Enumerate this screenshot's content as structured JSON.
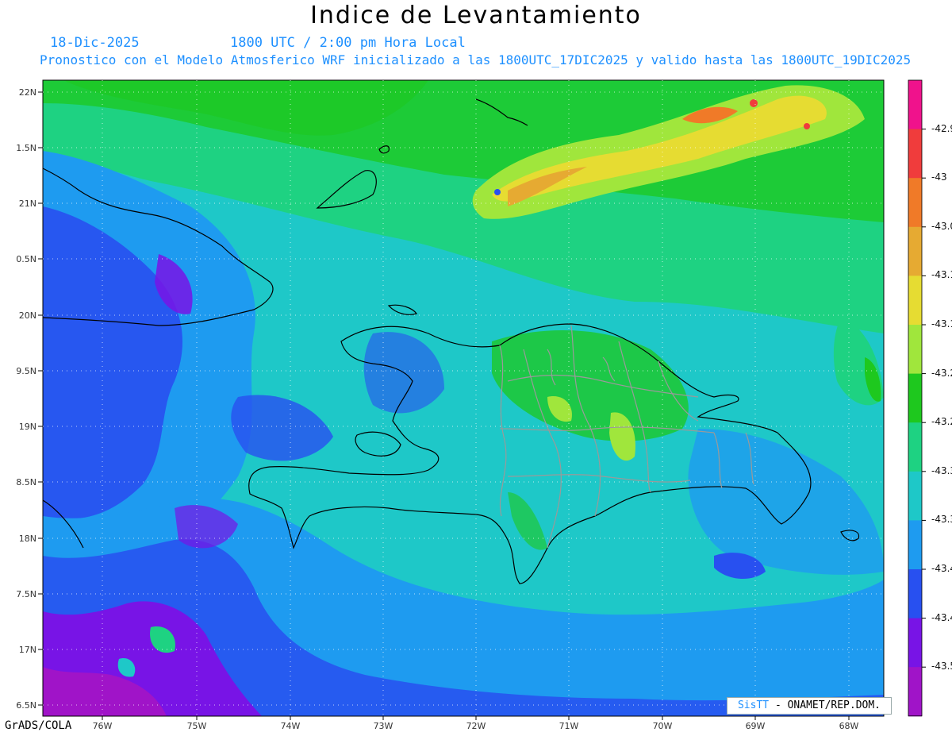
{
  "title": "Indice de Levantamiento",
  "date": "18-Dic-2025",
  "time": "1800 UTC / 2:00 pm Hora Local",
  "forecast_note": "Pronostico con el Modelo Atmosferico WRF inicializado a las 1800UTC_17DIC2025 y valido hasta las  1800UTC_19DIC2025",
  "footer_left": "GrADS/COLA",
  "credit": {
    "brand": "SisTT",
    "rest": "- ONAMET/REP.DOM."
  },
  "lat_labels": [
    "22N",
    "1.5N",
    "21N",
    "0.5N",
    "20N",
    "9.5N",
    "19N",
    "8.5N",
    "18N",
    "7.5N",
    "17N",
    "6.5N"
  ],
  "lon_labels": [
    "76W",
    "75W",
    "74W",
    "73W",
    "72W",
    "71W",
    "70W",
    "69W",
    "68W"
  ],
  "legend": {
    "colors": [
      "#f0128c",
      "#f03c3c",
      "#f07a28",
      "#e6aa32",
      "#e6dc32",
      "#a0e63c",
      "#1ec81e",
      "#1ed282",
      "#1ec8c8",
      "#1e9bf0",
      "#2850f0",
      "#7814e6",
      "#a014c8"
    ],
    "labels": [
      "-42.9",
      "-43",
      "-43.0",
      "-43.1",
      "-43.1",
      "-43.2",
      "-43.2",
      "-43.3",
      "-43.3",
      "-43.4",
      "-43.4",
      "-43.5"
    ]
  }
}
